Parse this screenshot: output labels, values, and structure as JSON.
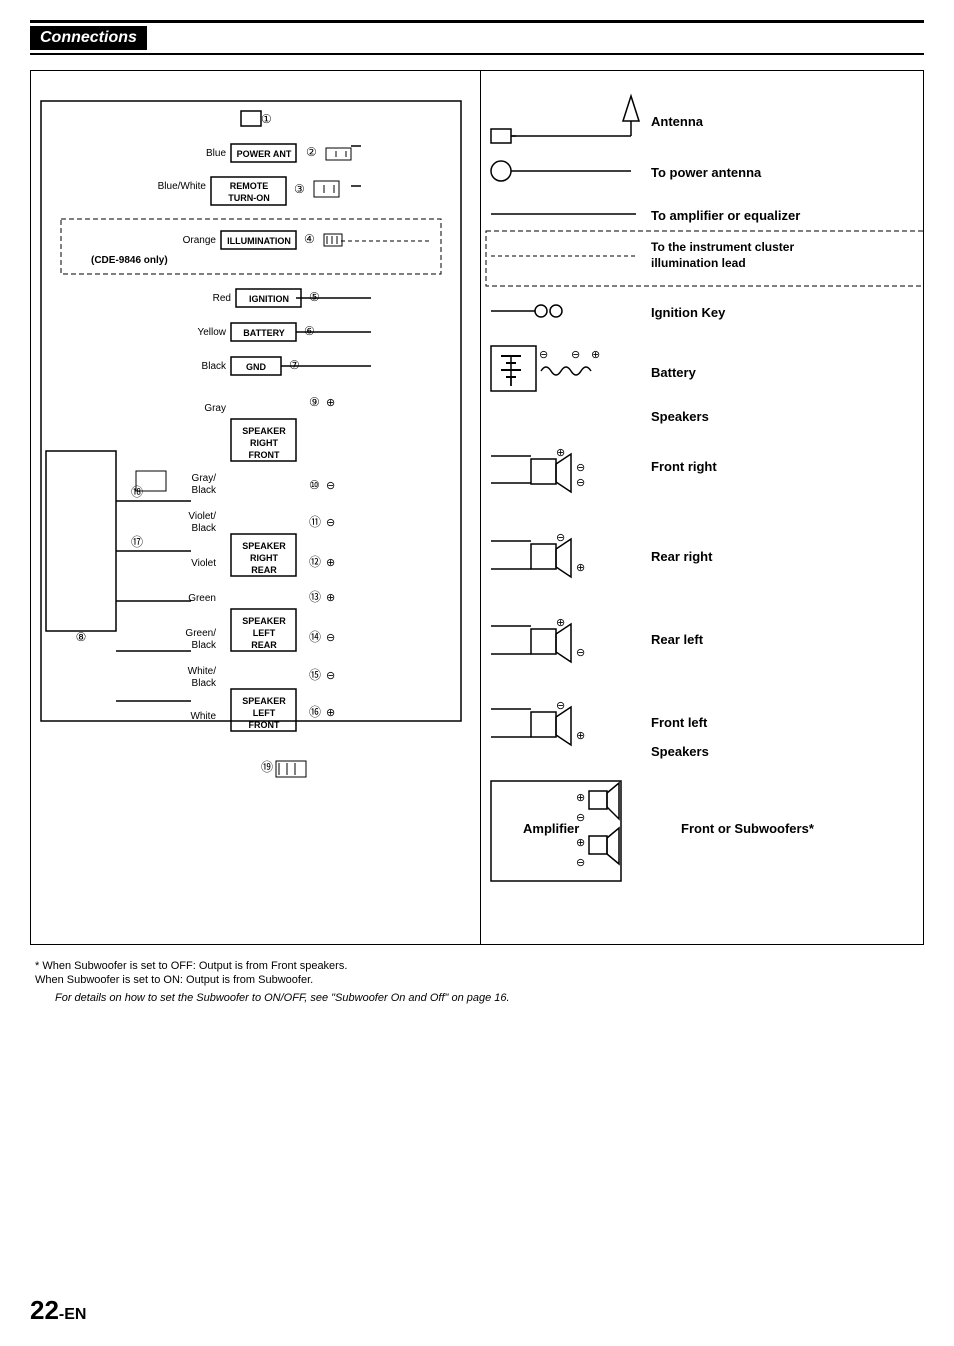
{
  "header": {
    "title": "Connections"
  },
  "left_labels": {
    "blue": "Blue",
    "blue_white": "Blue/White",
    "orange": "Orange",
    "red": "Red",
    "yellow": "Yellow",
    "black": "Black",
    "gray": "Gray",
    "gray_black": "Gray/\nBlack",
    "violet_black": "Violet/\nBlack",
    "violet": "Violet",
    "green": "Green",
    "green_black": "Green/\nBlack",
    "white_black": "White/\nBlack",
    "white": "White"
  },
  "connectors": {
    "power_ant": "POWER ANT",
    "remote_turn_on": "REMOTE\nTURN-ON",
    "illumination": "ILLUMINATION",
    "cde_only": "(CDE-9846 only)",
    "ignition": "IGNITION",
    "battery": "BATTERY",
    "gnd": "GND",
    "speaker_right_front": "SPEAKER\nRIGHT\nFRONT",
    "speaker_right_rear": "SPEAKER\nRIGHT\nREAR",
    "speaker_left_rear": "SPEAKER\nLEFT\nREAR",
    "speaker_left_front": "SPEAKER\nLEFT\nFRONT"
  },
  "pin_numbers": {
    "p1": "①",
    "p2": "②",
    "p3": "③",
    "p4": "④",
    "p5": "⑤",
    "p6": "⑥",
    "p7": "⑦",
    "p8": "⑧",
    "p9": "⑨",
    "p10": "⑩",
    "p11": "⑪",
    "p12": "⑫",
    "p13": "⑬",
    "p14": "⑭",
    "p15": "⑮",
    "p16": "⑯",
    "p17": "⑰",
    "p18": "⑱",
    "p19": "⑲"
  },
  "right_labels": {
    "antenna": "Antenna",
    "to_power_antenna": "To power antenna",
    "to_amplifier": "To amplifier or equalizer",
    "to_instrument_cluster": "To the instrument cluster\nillumination lead",
    "ignition_key": "Ignition Key",
    "battery": "Battery",
    "speakers": "Speakers",
    "front_right": "Front right",
    "rear_right": "Rear right",
    "rear_left": "Rear left",
    "front_left": "Front left",
    "speakers2": "Speakers",
    "amplifier": "Amplifier",
    "front_or_subwoofers": "Front or Subwoofers*"
  },
  "footnotes": {
    "asterisk_note1": "*  When Subwoofer is set to OFF: Output is from Front speakers.",
    "asterisk_note2": "   When Subwoofer is set to ON: Output is from Subwoofer.",
    "italic_note": "For details on how to  set the Subwoofer to ON/OFF, see \"Subwoofer On and Off\" on page 16."
  },
  "page_number": "22",
  "page_suffix": "-EN"
}
